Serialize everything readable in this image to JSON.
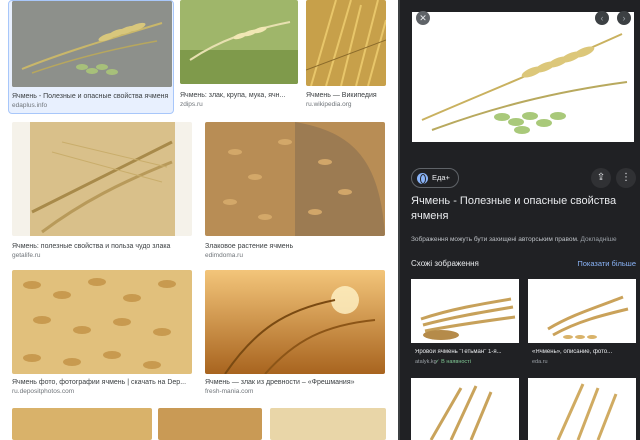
{
  "results": [
    {
      "caption": "Ячмень - Полезные и опасные свойства ячменя",
      "source": "edaplus.info"
    },
    {
      "caption": "Ячмень: злак, крупа, мука, ячн...",
      "source": "zdips.ru"
    },
    {
      "caption": "Ячмень — Википедия",
      "source": "ru.wikipedia.org"
    },
    {
      "caption": "Ячмень: полезные свойства и польза чудо злака",
      "source": "getalife.ru"
    },
    {
      "caption": "Злаковое растение ячмень",
      "source": "edimdoma.ru"
    },
    {
      "caption": "Ячмень фото, фотографии ячмень | скачать на Dep...",
      "source": "ru.depositphotos.com"
    },
    {
      "caption": "Ячмень — злак из древности – «Фрешмания»",
      "source": "fresh-mania.com"
    }
  ],
  "panel": {
    "close_icon": "✕",
    "prev_icon": "‹",
    "next_icon": "›",
    "chip_label": "Еда+",
    "share_icon": "⇪",
    "more_icon": "⋮",
    "title": "Ячмень - Полезные и опасные свойства ячменя",
    "notice": "Зображення можуть бути захищені авторським правом.",
    "notice_more": "Докладніше",
    "similar_heading": "Схожі зображення",
    "show_more": "Показати більше",
    "similar": [
      {
        "caption": "Яровой ячмень \"Гетьман\" 1-я...",
        "source": "atalyk.kg",
        "stock": "✓ В наявності"
      },
      {
        "caption": "«Ячмень», описание, фото...",
        "source": "eda.ru"
      }
    ]
  }
}
